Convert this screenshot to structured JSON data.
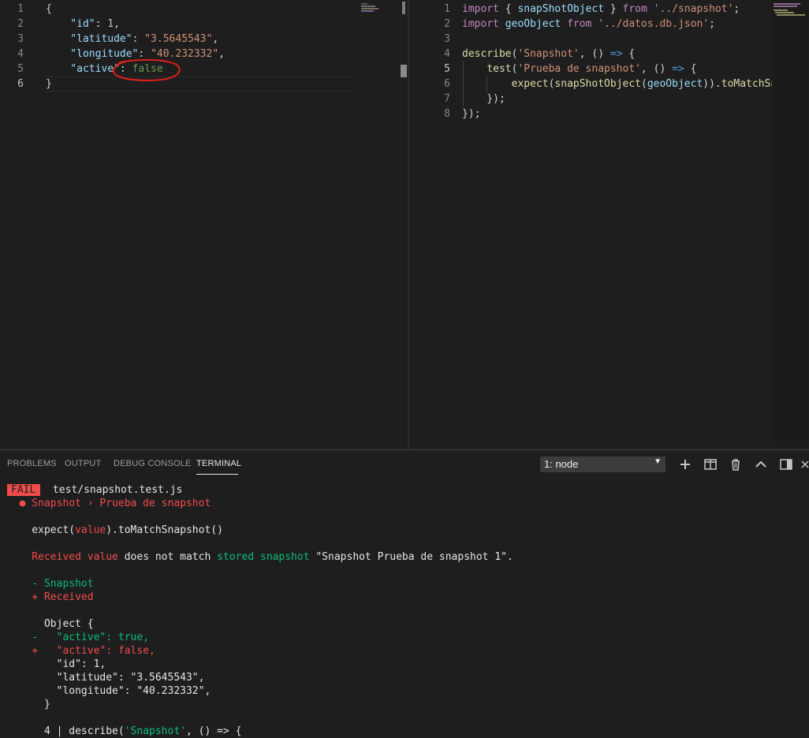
{
  "left_editor": {
    "lines": [
      {
        "n": "1",
        "parts": [
          {
            "t": "{",
            "c": "p"
          }
        ]
      },
      {
        "n": "2",
        "parts": [
          {
            "t": "    \"id\"",
            "c": "prop"
          },
          {
            "t": ": ",
            "c": "p"
          },
          {
            "t": "1",
            "c": "num"
          },
          {
            "t": ",",
            "c": "p"
          }
        ]
      },
      {
        "n": "3",
        "parts": [
          {
            "t": "    \"latitude\"",
            "c": "prop"
          },
          {
            "t": ": ",
            "c": "p"
          },
          {
            "t": "\"3.5645543\"",
            "c": "s"
          },
          {
            "t": ",",
            "c": "p"
          }
        ]
      },
      {
        "n": "4",
        "parts": [
          {
            "t": "    \"longitude\"",
            "c": "prop"
          },
          {
            "t": ": ",
            "c": "p"
          },
          {
            "t": "\"40.232332\"",
            "c": "s"
          },
          {
            "t": ",",
            "c": "p"
          }
        ]
      },
      {
        "n": "5",
        "parts": [
          {
            "t": "    \"active\"",
            "c": "prop"
          },
          {
            "t": ": ",
            "c": "p"
          },
          {
            "t": "false",
            "c": "bool-green"
          }
        ]
      },
      {
        "n": "6",
        "parts": [
          {
            "t": "}",
            "c": "p"
          }
        ]
      }
    ]
  },
  "right_editor": {
    "lines": [
      {
        "n": "1",
        "parts": [
          {
            "t": "import",
            "c": "k"
          },
          {
            "t": " { ",
            "c": "p"
          },
          {
            "t": "snapShotObject",
            "c": "prop"
          },
          {
            "t": " } ",
            "c": "p"
          },
          {
            "t": "from",
            "c": "k"
          },
          {
            "t": " ",
            "c": "p"
          },
          {
            "t": "'../snapshot'",
            "c": "s"
          },
          {
            "t": ";",
            "c": "p"
          }
        ]
      },
      {
        "n": "2",
        "parts": [
          {
            "t": "import",
            "c": "k"
          },
          {
            "t": " ",
            "c": "p"
          },
          {
            "t": "geoObject",
            "c": "prop"
          },
          {
            "t": " ",
            "c": "p"
          },
          {
            "t": "from",
            "c": "k"
          },
          {
            "t": " ",
            "c": "p"
          },
          {
            "t": "'../datos.db.json'",
            "c": "s"
          },
          {
            "t": ";",
            "c": "p"
          }
        ]
      },
      {
        "n": "3",
        "parts": []
      },
      {
        "n": "4",
        "parts": [
          {
            "t": "describe",
            "c": "fn"
          },
          {
            "t": "(",
            "c": "p"
          },
          {
            "t": "'Snapshot'",
            "c": "s"
          },
          {
            "t": ", () ",
            "c": "p"
          },
          {
            "t": "=>",
            "c": "kw"
          },
          {
            "t": " {",
            "c": "p"
          }
        ]
      },
      {
        "n": "5",
        "parts": [
          {
            "t": "    ",
            "c": "p"
          },
          {
            "t": "test",
            "c": "fn"
          },
          {
            "t": "(",
            "c": "p"
          },
          {
            "t": "'Prueba de snapshot'",
            "c": "s"
          },
          {
            "t": ", () ",
            "c": "p"
          },
          {
            "t": "=>",
            "c": "kw"
          },
          {
            "t": " {",
            "c": "p"
          }
        ]
      },
      {
        "n": "6",
        "parts": [
          {
            "t": "        ",
            "c": "p"
          },
          {
            "t": "expect",
            "c": "fn"
          },
          {
            "t": "(",
            "c": "p"
          },
          {
            "t": "snapShotObject",
            "c": "fn"
          },
          {
            "t": "(",
            "c": "p"
          },
          {
            "t": "geoObject",
            "c": "prop"
          },
          {
            "t": ")).",
            "c": "p"
          },
          {
            "t": "toMatchSna",
            "c": "fn"
          }
        ]
      },
      {
        "n": "7",
        "parts": [
          {
            "t": "    });",
            "c": "p"
          }
        ]
      },
      {
        "n": "8",
        "parts": [
          {
            "t": "});",
            "c": "p"
          }
        ]
      }
    ]
  },
  "panel": {
    "tabs": [
      "PROBLEMS",
      "OUTPUT",
      "DEBUG CONSOLE",
      "TERMINAL"
    ],
    "terminal_select": "1: node",
    "terminal_select_arrow": "▼"
  },
  "terminal": {
    "lines": [
      {
        "parts": [
          {
            "t": "FAIL",
            "c": "fail-badge"
          },
          {
            "t": "  test/snapshot.test.js",
            "c": "t-white"
          }
        ]
      },
      {
        "parts": [
          {
            "t": "  ● Snapshot › Prueba de snapshot",
            "c": "t-red"
          }
        ]
      },
      {
        "parts": []
      },
      {
        "parts": [
          {
            "t": "    expect(",
            "c": "t-white"
          },
          {
            "t": "value",
            "c": "t-red"
          },
          {
            "t": ").toMatchSnapshot()",
            "c": "t-white"
          }
        ]
      },
      {
        "parts": []
      },
      {
        "parts": [
          {
            "t": "    Received value",
            "c": "t-red"
          },
          {
            "t": " does not match ",
            "c": "t-white"
          },
          {
            "t": "stored snapshot",
            "c": "t-green2"
          },
          {
            "t": " \"Snapshot Prueba de snapshot 1\".",
            "c": "t-white"
          }
        ]
      },
      {
        "parts": []
      },
      {
        "parts": [
          {
            "t": "    - Snapshot",
            "c": "t-green2"
          }
        ]
      },
      {
        "parts": [
          {
            "t": "    + Received",
            "c": "t-red"
          }
        ]
      },
      {
        "parts": []
      },
      {
        "parts": [
          {
            "t": "      Object {",
            "c": "t-white"
          }
        ]
      },
      {
        "parts": [
          {
            "t": "    -   \"active\": true,",
            "c": "t-green2"
          }
        ]
      },
      {
        "parts": [
          {
            "t": "    +   \"active\": false,",
            "c": "t-red"
          }
        ]
      },
      {
        "parts": [
          {
            "t": "        \"id\": 1,",
            "c": "t-white"
          }
        ]
      },
      {
        "parts": [
          {
            "t": "        \"latitude\": \"3.5645543\",",
            "c": "t-white"
          }
        ]
      },
      {
        "parts": [
          {
            "t": "        \"longitude\": \"40.232332\",",
            "c": "t-white"
          }
        ]
      },
      {
        "parts": [
          {
            "t": "      }",
            "c": "t-white"
          }
        ]
      },
      {
        "parts": []
      },
      {
        "parts": [
          {
            "t": "      4 | describe(",
            "c": "t-white"
          },
          {
            "t": "'Snapshot'",
            "c": "t-green2"
          },
          {
            "t": ", () => {",
            "c": "t-white"
          }
        ]
      }
    ]
  }
}
